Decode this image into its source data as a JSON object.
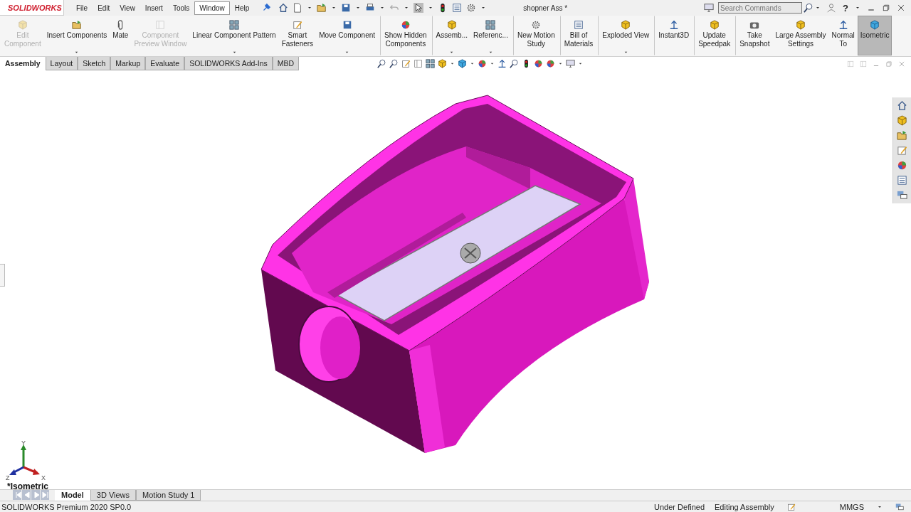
{
  "title_bar": {
    "logo": "SOLIDWORKS",
    "menus": [
      {
        "label": "File",
        "selected": false
      },
      {
        "label": "Edit",
        "selected": false
      },
      {
        "label": "View",
        "selected": false
      },
      {
        "label": "Insert",
        "selected": false
      },
      {
        "label": "Tools",
        "selected": false
      },
      {
        "label": "Window",
        "selected": true
      },
      {
        "label": "Help",
        "selected": false
      }
    ],
    "document_title": "shopner Ass *",
    "search": {
      "placeholder": "Search Commands"
    },
    "help": "?"
  },
  "ribbon": {
    "commands": [
      {
        "label": "Edit\nComponent",
        "disabled": true,
        "dropdown": false,
        "selected": false,
        "separator_before": false
      },
      {
        "label": "Insert Components",
        "disabled": false,
        "dropdown": true,
        "selected": false,
        "separator_before": false
      },
      {
        "label": "Mate",
        "disabled": false,
        "dropdown": false,
        "selected": false,
        "separator_before": false
      },
      {
        "label": "Component\nPreview Window",
        "disabled": true,
        "dropdown": false,
        "selected": false,
        "separator_before": false
      },
      {
        "label": "Linear Component Pattern",
        "disabled": false,
        "dropdown": true,
        "selected": false,
        "separator_before": false
      },
      {
        "label": "Smart\nFasteners",
        "disabled": false,
        "dropdown": false,
        "selected": false,
        "separator_before": false
      },
      {
        "label": "Move Component",
        "disabled": false,
        "dropdown": true,
        "selected": false,
        "separator_before": false
      },
      {
        "label": "Show Hidden\nComponents",
        "disabled": false,
        "dropdown": false,
        "selected": false,
        "separator_before": true
      },
      {
        "label": "Assemb...",
        "disabled": false,
        "dropdown": true,
        "selected": false,
        "separator_before": true
      },
      {
        "label": "Referenc...",
        "disabled": false,
        "dropdown": true,
        "selected": false,
        "separator_before": false
      },
      {
        "label": "New Motion\nStudy",
        "disabled": false,
        "dropdown": false,
        "selected": false,
        "separator_before": true
      },
      {
        "label": "Bill of\nMaterials",
        "disabled": false,
        "dropdown": false,
        "selected": false,
        "separator_before": true
      },
      {
        "label": "Exploded View",
        "disabled": false,
        "dropdown": true,
        "selected": false,
        "separator_before": true
      },
      {
        "label": "Instant3D",
        "disabled": false,
        "dropdown": false,
        "selected": false,
        "separator_before": true
      },
      {
        "label": "Update\nSpeedpak",
        "disabled": false,
        "dropdown": false,
        "selected": false,
        "separator_before": true
      },
      {
        "label": "Take\nSnapshot",
        "disabled": false,
        "dropdown": false,
        "selected": false,
        "separator_before": true
      },
      {
        "label": "Large Assembly\nSettings",
        "disabled": false,
        "dropdown": false,
        "selected": false,
        "separator_before": false
      },
      {
        "label": "Normal\nTo",
        "disabled": false,
        "dropdown": false,
        "selected": false,
        "separator_before": false
      },
      {
        "label": "Isometric",
        "disabled": false,
        "dropdown": false,
        "selected": true,
        "separator_before": false
      }
    ]
  },
  "tabs": [
    {
      "label": "Assembly",
      "selected": true
    },
    {
      "label": "Layout",
      "selected": false
    },
    {
      "label": "Sketch",
      "selected": false
    },
    {
      "label": "Markup",
      "selected": false
    },
    {
      "label": "Evaluate",
      "selected": false
    },
    {
      "label": "SOLIDWORKS Add-Ins",
      "selected": false
    },
    {
      "label": "MBD",
      "selected": false
    }
  ],
  "viewport": {
    "view_name": "*Isometric",
    "triad": {
      "x": "X",
      "y": "Y",
      "z": "Z"
    }
  },
  "bottom_tabs": [
    {
      "label": "Model",
      "selected": true
    },
    {
      "label": "3D Views",
      "selected": false
    },
    {
      "label": "Motion Study 1",
      "selected": false
    }
  ],
  "status_bar": {
    "product": "SOLIDWORKS Premium 2020 SP0.0",
    "state": "Under Defined",
    "mode": "Editing Assembly",
    "units": "MMGS"
  }
}
